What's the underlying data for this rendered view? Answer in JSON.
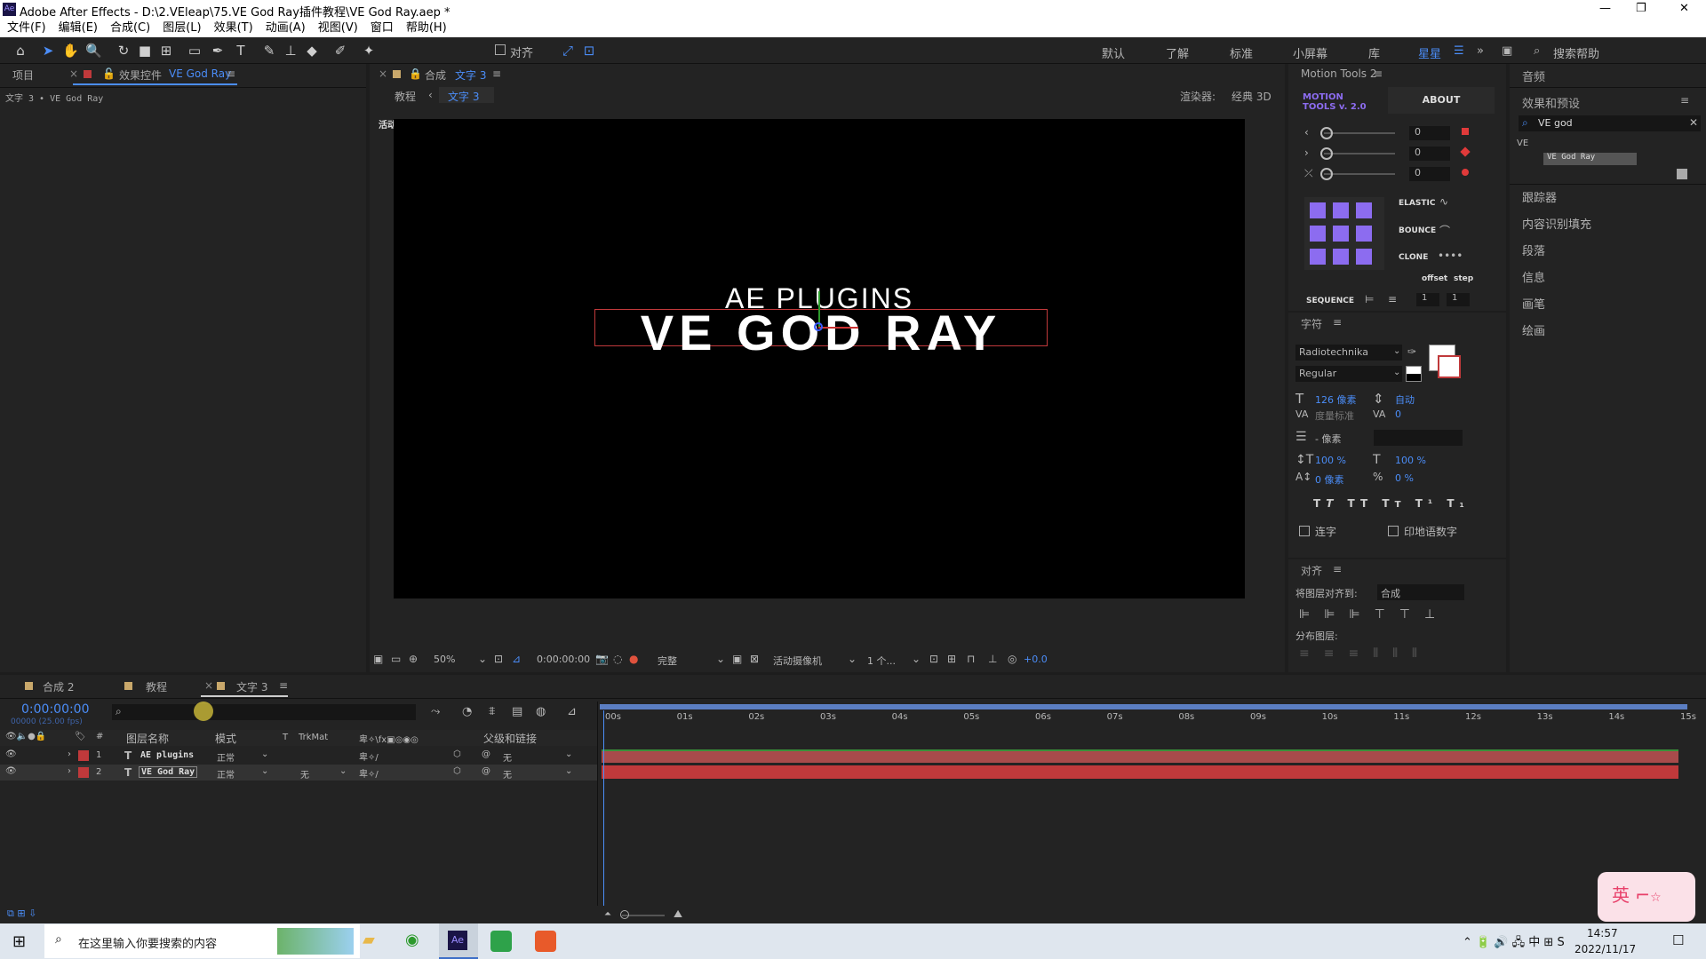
{
  "window": {
    "title": "Adobe After Effects - D:\\2.VEleap\\75.VE God Ray插件教程\\VE God Ray.aep *",
    "minimize": "—",
    "maximize": "❐",
    "close": "✕"
  },
  "menu": [
    "文件(F)",
    "编辑(E)",
    "合成(C)",
    "图层(L)",
    "效果(T)",
    "动画(A)",
    "视图(V)",
    "窗口",
    "帮助(H)"
  ],
  "toolbar": {
    "snap_label": "对齐",
    "workspaces": [
      "默认",
      "了解",
      "标准",
      "小屏幕",
      "库",
      "星星"
    ],
    "search_placeholder": "搜索帮助"
  },
  "project_panel": {
    "tab_project": "项目",
    "tab_effects": "效果控件",
    "effects_target": "VE God Ray",
    "breadcrumb": "文字 3 • VE God Ray"
  },
  "comp_panel": {
    "tab_prefix": "合成",
    "tab_name": "文字 3",
    "nav_parent": "教程",
    "nav_current": "文字 3",
    "renderer_label": "渲染器:",
    "renderer_value": "经典 3D",
    "camera_label": "活动摄像机",
    "text_top": "AE PLUGINS",
    "text_main": "VE GOD RAY"
  },
  "comp_footer": {
    "zoom": "50%",
    "timecode": "0:00:00:00",
    "quality": "完整",
    "camera": "活动摄像机",
    "views": "1 个...",
    "exposure": "+0.0"
  },
  "motion_tools": {
    "title": "Motion Tools 2",
    "logo_line1": "MOTION",
    "logo_line2": "TOOLS v. 2.0",
    "about": "ABOUT",
    "values": [
      "0",
      "0",
      "0"
    ],
    "elastic": "ELASTIC",
    "bounce": "BOUNCE",
    "clone": "CLONE",
    "offset": "offset",
    "step": "step",
    "sequence": "SEQUENCE",
    "seq_vals": [
      "1",
      "1"
    ]
  },
  "character": {
    "title": "字符",
    "font": "Radiotechnika",
    "style": "Regular",
    "size": "126 像素",
    "leading": "自动",
    "kerning": "度量标准",
    "tracking": "0",
    "stroke_width": "- 像素",
    "v_scale": "100 %",
    "h_scale": "100 %",
    "baseline": "0 像素",
    "tsume": "0 %",
    "ligature": "连字",
    "hindi": "印地语数字"
  },
  "align": {
    "title": "对齐",
    "align_to_label": "将图层对齐到:",
    "align_to_value": "合成",
    "distribute_label": "分布图层:"
  },
  "right_panel": {
    "audio": "音频",
    "effects_presets": "效果和预设",
    "search_value": "VE god",
    "tree_group": "VE",
    "tree_item": "VE God Ray",
    "items": [
      "跟踪器",
      "内容识别填充",
      "段落",
      "信息",
      "画笔",
      "绘画"
    ]
  },
  "timeline": {
    "tabs": [
      "合成 2",
      "教程",
      "文字 3"
    ],
    "timecode": "0:00:00:00",
    "fps": "00000 (25.00 fps)",
    "columns": [
      "图层名称",
      "模式",
      "T",
      "TrkMat",
      "父级和链接"
    ],
    "layers": [
      {
        "num": "1",
        "name": "AE plugins",
        "mode": "正常",
        "trkmat": "",
        "parent": "无"
      },
      {
        "num": "2",
        "name": "VE God Ray",
        "mode": "正常",
        "trkmat": "无",
        "parent": "无"
      }
    ],
    "ruler": [
      "00s",
      "01s",
      "02s",
      "03s",
      "04s",
      "05s",
      "06s",
      "07s",
      "08s",
      "09s",
      "10s",
      "11s",
      "12s",
      "13s",
      "14s",
      "15s"
    ]
  },
  "taskbar": {
    "search": "在这里输入你要搜索的内容",
    "time": "14:57",
    "date": "2022/11/17",
    "ime": "英",
    "ime_cn": "中"
  },
  "colors": {
    "accent": "#4b8df8",
    "layer_red": "#c0393b",
    "bar_red": "#a84b4b",
    "bar_green": "#3a8f3a"
  }
}
